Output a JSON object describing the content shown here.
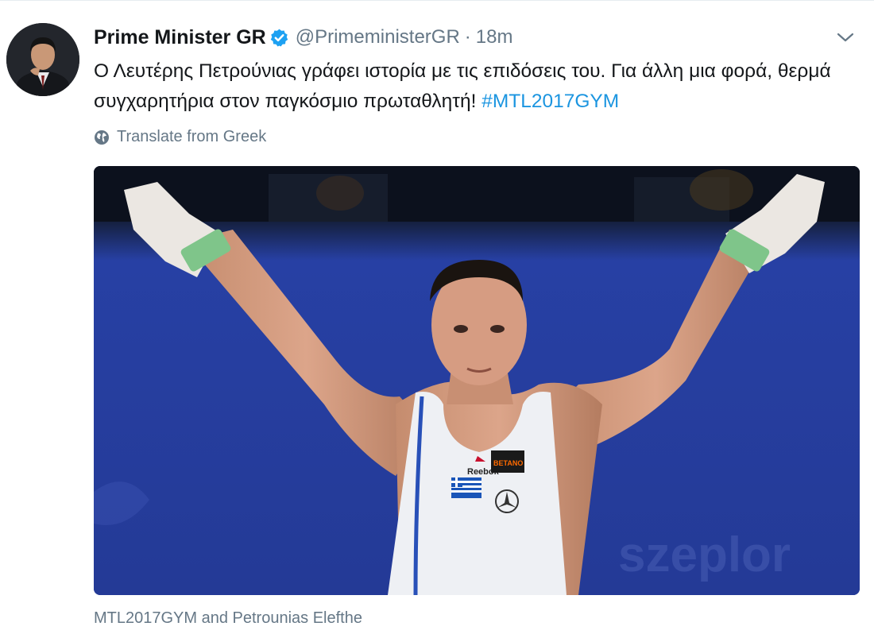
{
  "tweet": {
    "display_name": "Prime Minister GR",
    "handle": "@PrimeministerGR",
    "separator": "·",
    "time": "18m",
    "verified_icon": "verified-badge-icon",
    "menu_icon": "chevron-down-icon",
    "text_main": "Ο Λευτέρης Πετρούνιας γράφει ιστορία με τις επιδόσεις του. Για άλλη μια φορά, θερμά συγχαρητήρια στον παγκόσμιο πρωταθλητή! ",
    "hashtag": "#MTL2017GYM",
    "translate_label": "Translate from Greek",
    "translate_icon": "globe-icon",
    "media_caption": "MTL2017GYM and Petrounias Elefthe",
    "jersey_brand": "Reebok",
    "jersey_sponsor": "BETANO"
  },
  "colors": {
    "text": "#14171a",
    "secondary": "#657786",
    "link": "#1b95e0",
    "verified": "#1da1f2",
    "arena_blue": "#2a3fa0"
  }
}
